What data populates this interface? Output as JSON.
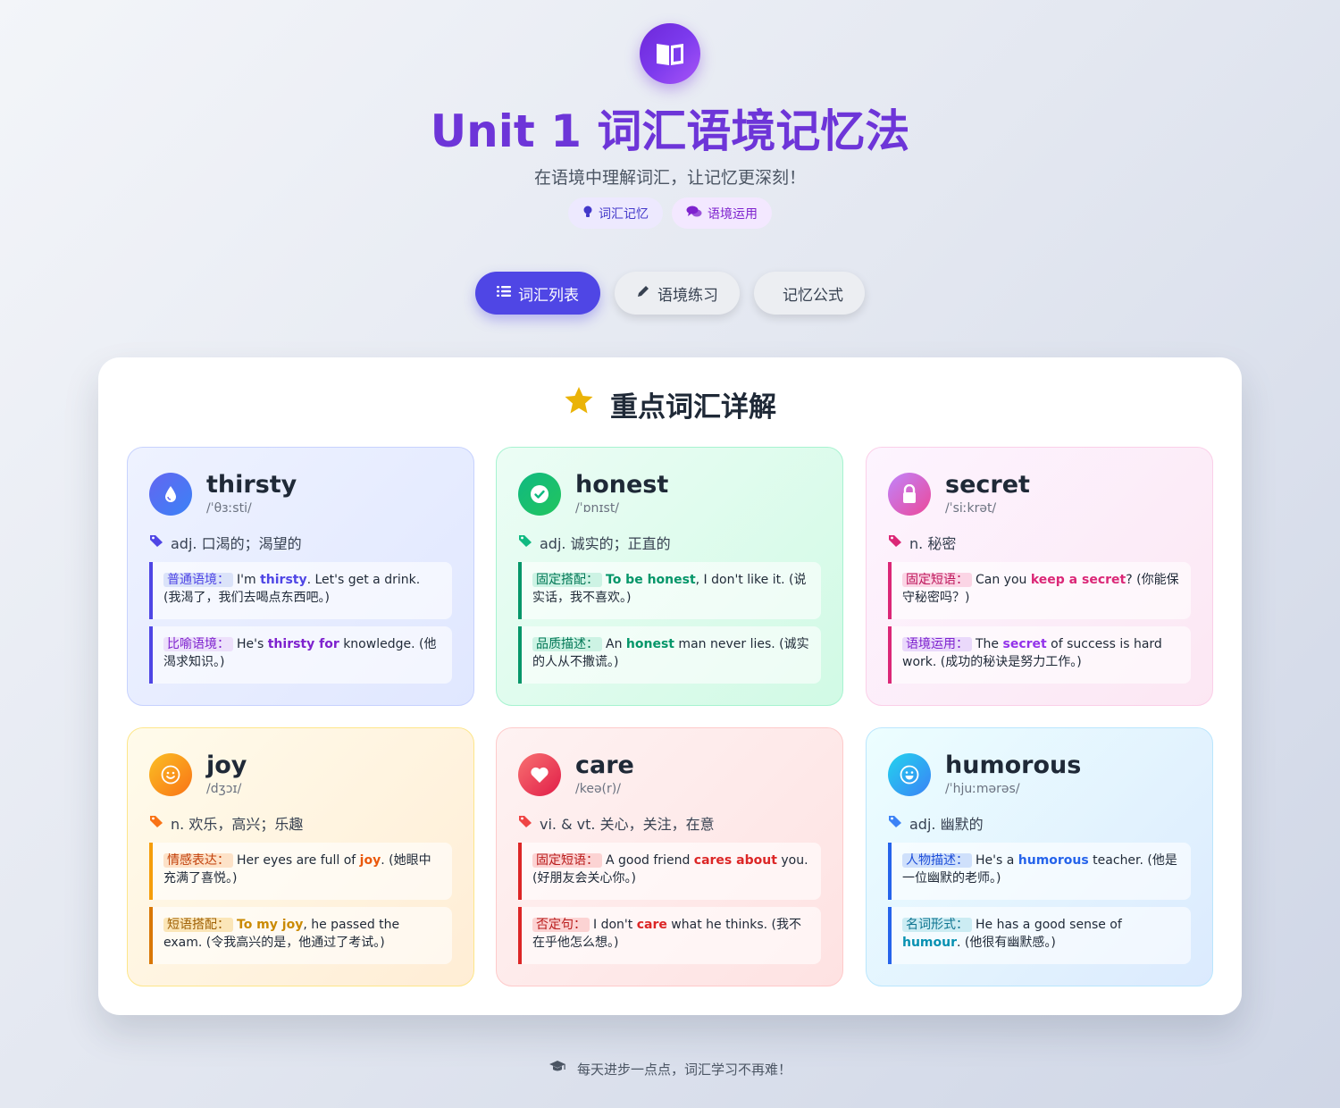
{
  "header": {
    "title": "Unit 1 词汇语境记忆法",
    "subtitle": "在语境中理解词汇，让记忆更深刻！",
    "tags": [
      {
        "label": "词汇记忆",
        "icon": "lightbulb-icon"
      },
      {
        "label": "语境运用",
        "icon": "chat-bubbles-icon"
      }
    ]
  },
  "nav": [
    {
      "label": "词汇列表",
      "icon": "list-icon",
      "active": true
    },
    {
      "label": "语境练习",
      "icon": "pencil-icon",
      "active": false
    },
    {
      "label": "记忆公式",
      "icon": "",
      "active": false
    }
  ],
  "panel": {
    "title": "重点词汇详解",
    "icon": "star-icon"
  },
  "cards": [
    {
      "word": "thirsty",
      "phonetic": "/ˈθɜːsti/",
      "meaning": "adj. 口渴的；渴望的",
      "icon": "droplet-icon",
      "accent": "#5b6ee8",
      "examples": [
        {
          "label": "普通语境：",
          "pre": "I'm ",
          "hl": "thirsty",
          "post": ". Let's get a drink. (我渴了，我们去喝点东西吧。)"
        },
        {
          "label": "比喻语境：",
          "pre": "He's ",
          "hl": "thirsty for",
          "post": " knowledge. (他渴求知识。)"
        }
      ]
    },
    {
      "word": "honest",
      "phonetic": "/ˈɒnɪst/",
      "meaning": "adj. 诚实的；正直的",
      "icon": "check-circle-icon",
      "accent": "#10b981",
      "examples": [
        {
          "label": "固定搭配：",
          "pre": "",
          "hl": "To be honest",
          "post": ", I don't like it. (说实话，我不喜欢。)"
        },
        {
          "label": "品质描述：",
          "pre": "An ",
          "hl": "honest",
          "post": " man never lies. (诚实的人从不撒谎。)"
        }
      ]
    },
    {
      "word": "secret",
      "phonetic": "/ˈsiːkrət/",
      "meaning": "n. 秘密",
      "icon": "lock-icon",
      "accent": "#ec4899",
      "examples": [
        {
          "label": "固定短语：",
          "pre": "Can you ",
          "hl": "keep a secret",
          "post": "? (你能保守秘密吗？)"
        },
        {
          "label": "语境运用：",
          "pre": "The ",
          "hl": "secret",
          "post": " of success is hard work. (成功的秘诀是努力工作。)"
        }
      ]
    },
    {
      "word": "joy",
      "phonetic": "/dʒɔɪ/",
      "meaning": "n. 欢乐，高兴；乐趣",
      "icon": "smile-icon",
      "accent": "#f59e0b",
      "examples": [
        {
          "label": "情感表达：",
          "pre": "Her eyes are full of ",
          "hl": "joy",
          "post": ". (她眼中充满了喜悦。)"
        },
        {
          "label": "短语搭配：",
          "pre": "",
          "hl": "To my joy",
          "post": ", he passed the exam. (令我高兴的是，他通过了考试。)"
        }
      ]
    },
    {
      "word": "care",
      "phonetic": "/keə(r)/",
      "meaning": "vi. & vt. 关心，关注，在意",
      "icon": "heart-icon",
      "accent": "#ef4444",
      "examples": [
        {
          "label": "固定短语：",
          "pre": "A good friend ",
          "hl": "cares about",
          "post": " you. (好朋友会关心你。)"
        },
        {
          "label": "否定句：",
          "pre": "I don't ",
          "hl": "care",
          "post": " what he thinks. (我不在乎他怎么想。)"
        }
      ]
    },
    {
      "word": "humorous",
      "phonetic": "/ˈhjuːmərəs/",
      "meaning": "adj. 幽默的",
      "icon": "laugh-icon",
      "accent": "#0ea5e9",
      "examples": [
        {
          "label": "人物描述：",
          "pre": "He's a ",
          "hl": "humorous",
          "post": " teacher. (他是一位幽默的老师。)"
        },
        {
          "label": "名词形式：",
          "pre": "He has a good sense of ",
          "hl": "humour",
          "post": ". (他很有幽默感。)"
        }
      ]
    }
  ],
  "footer": {
    "text": "每天进步一点点，词汇学习不再难！",
    "icon": "graduation-cap-icon"
  }
}
